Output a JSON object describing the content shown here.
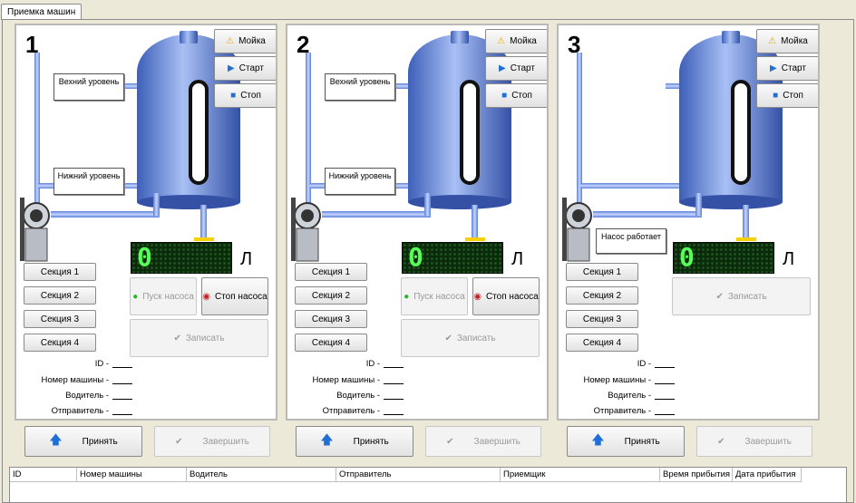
{
  "tab": {
    "label": "Приемка машин"
  },
  "labels": {
    "moika": "Мойка",
    "start": "Старт",
    "stop": "Стоп",
    "upper": "Вехний уровень",
    "lower": "Нижний уровень",
    "pump_start": "Пуск насоса",
    "pump_stop": "Стоп насоса",
    "write": "Записать",
    "unit": "Л",
    "pump_running": "Насос работает",
    "id": "ID -",
    "car": "Номер машины -",
    "driver": "Водитель -",
    "sender": "Отправитель -",
    "accept": "Принять",
    "finish": "Завершить"
  },
  "sections": [
    "Секция 1",
    "Секция 2",
    "Секция 3",
    "Секция 4"
  ],
  "panels": [
    {
      "number": "1",
      "lcd": "0"
    },
    {
      "number": "2",
      "lcd": "0"
    },
    {
      "number": "3",
      "lcd": "0"
    }
  ],
  "table_headers": [
    "ID",
    "Номер машины",
    "Водитель",
    "Отправитель",
    "Приемщик",
    "Время прибытия",
    "Дата прибытия"
  ],
  "colors": {
    "tank": "#6f8ee0",
    "lcd": "#59ff59",
    "accent": "#1f6fd6"
  }
}
